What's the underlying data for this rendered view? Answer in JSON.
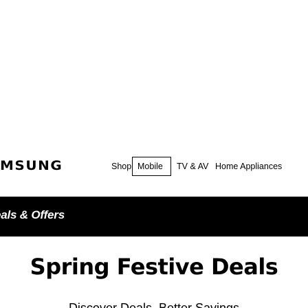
{
  "brand": {
    "logo_text": "MSUNG"
  },
  "nav": {
    "items": [
      {
        "label": "Shop"
      },
      {
        "label": "Mobile",
        "selected": true
      },
      {
        "label": "TV & AV"
      },
      {
        "label": "Home Appliances"
      }
    ]
  },
  "banner": {
    "text": "eals & Offers",
    "background": "#000000",
    "text_color": "#ffffff"
  },
  "main": {
    "headline": "Spring Festive Deals",
    "subline": "Discover Deals, Better Savings"
  }
}
